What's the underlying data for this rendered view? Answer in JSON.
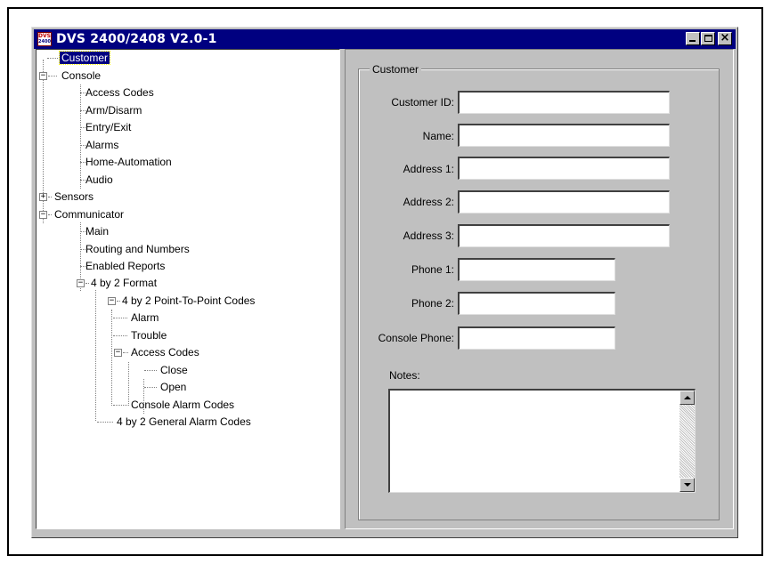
{
  "window": {
    "title": "DVS 2400/2408 V2.0-1",
    "icon_text_top": "DVS",
    "icon_text_bottom": "2400"
  },
  "tree": {
    "items": [
      {
        "label": "Customer",
        "selected": true
      },
      {
        "label": "Console",
        "expander": "−"
      },
      {
        "label": "Access Codes"
      },
      {
        "label": "Arm/Disarm"
      },
      {
        "label": "Entry/Exit"
      },
      {
        "label": "Alarms"
      },
      {
        "label": "Home-Automation"
      },
      {
        "label": "Audio"
      },
      {
        "label": "Sensors",
        "expander": "+"
      },
      {
        "label": "Communicator",
        "expander": "−"
      },
      {
        "label": "Main"
      },
      {
        "label": "Routing and Numbers"
      },
      {
        "label": "Enabled Reports"
      },
      {
        "label": "4 by 2 Format",
        "expander": "−"
      },
      {
        "label": "4 by 2 Point-To-Point Codes",
        "expander": "−"
      },
      {
        "label": "Alarm"
      },
      {
        "label": "Trouble"
      },
      {
        "label": "Access Codes",
        "expander": "−"
      },
      {
        "label": "Close"
      },
      {
        "label": "Open"
      },
      {
        "label": "Console Alarm Codes"
      },
      {
        "label": "4 by 2 General Alarm Codes"
      }
    ]
  },
  "form": {
    "group_title": "Customer",
    "fields": [
      {
        "label": "Customer ID:",
        "value": ""
      },
      {
        "label": "Name:",
        "value": ""
      },
      {
        "label": "Address 1:",
        "value": ""
      },
      {
        "label": "Address 2:",
        "value": ""
      },
      {
        "label": "Address 3:",
        "value": ""
      },
      {
        "label": "Phone 1:",
        "value": ""
      },
      {
        "label": "Phone 2:",
        "value": ""
      },
      {
        "label": "Console Phone:",
        "value": ""
      }
    ],
    "notes_label": "Notes:",
    "notes_value": ""
  },
  "colors": {
    "titlebar": "#000080",
    "face": "#c0c0c0",
    "selection": "#000080"
  }
}
